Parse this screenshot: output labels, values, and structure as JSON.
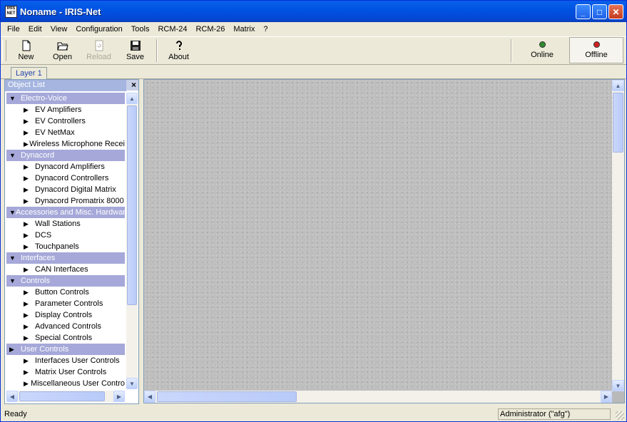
{
  "window": {
    "title": "Noname - IRIS-Net",
    "icon_text": "IRIS NET",
    "title_buttons": {
      "minimize": "_",
      "maximize": "□",
      "close": "✕"
    }
  },
  "menu": [
    "File",
    "Edit",
    "View",
    "Configuration",
    "Tools",
    "RCM-24",
    "RCM-26",
    "Matrix",
    "?"
  ],
  "toolbar": {
    "new_label": "New",
    "open_label": "Open",
    "reload_label": "Reload",
    "save_label": "Save",
    "about_label": "About",
    "online_label": "Online",
    "offline_label": "Offline",
    "online_led_color": "#2E8B2E",
    "offline_led_color": "#D02020"
  },
  "tabs": {
    "layer1": "Layer 1"
  },
  "object_list": {
    "title": "Object List",
    "close": "×",
    "categories": [
      {
        "label": "Electro-Voice",
        "expanded": true,
        "items": [
          "EV Amplifiers",
          "EV Controllers",
          "EV NetMax",
          "Wireless Microphone Recei"
        ]
      },
      {
        "label": "Dynacord",
        "expanded": true,
        "items": [
          "Dynacord Amplifiers",
          "Dynacord Controllers",
          "Dynacord Digital Matrix",
          "Dynacord Promatrix 8000"
        ]
      },
      {
        "label": "Accessories and Misc. Hardwar",
        "expanded": true,
        "items": [
          "Wall Stations",
          "DCS",
          "Touchpanels"
        ]
      },
      {
        "label": "Interfaces",
        "expanded": true,
        "items": [
          "CAN Interfaces"
        ]
      },
      {
        "label": "Controls",
        "expanded": true,
        "items": [
          "Button Controls",
          "Parameter Controls",
          "Display Controls",
          "Advanced Controls",
          "Special Controls"
        ]
      },
      {
        "label": "User Controls",
        "expanded": false,
        "items": [
          "Interfaces User Controls",
          "Matrix User Controls",
          "Miscellaneous User Contro"
        ]
      }
    ]
  },
  "scroll_arrows": {
    "up": "▲",
    "down": "▼",
    "left": "◀",
    "right": "▶"
  },
  "statusbar": {
    "left": "Ready",
    "user": "Administrator (\"afg\")"
  }
}
